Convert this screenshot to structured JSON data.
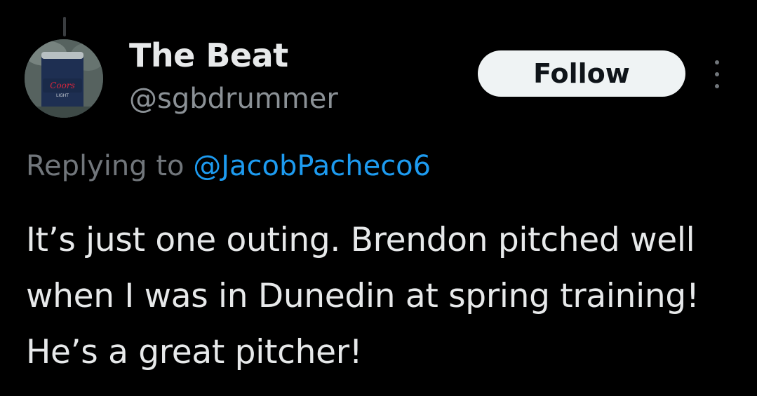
{
  "author": {
    "display_name": "The Beat",
    "handle": "@sgbdrummer",
    "avatar_icon": "beer-koozie-avatar"
  },
  "actions": {
    "follow_label": "Follow",
    "more_icon": "more-vertical-icon"
  },
  "reply": {
    "prefix": "Replying to ",
    "to_handle": "@JacobPacheco6"
  },
  "tweet": {
    "text": "It’s just one outing. Brendon pitched well when I was in Dunedin at spring training! He’s a great pitcher!"
  },
  "colors": {
    "background": "#000000",
    "primary_text": "#e7e9ea",
    "secondary_text": "#71767b",
    "link": "#1d9bf0",
    "follow_button_bg": "#eff3f4"
  }
}
